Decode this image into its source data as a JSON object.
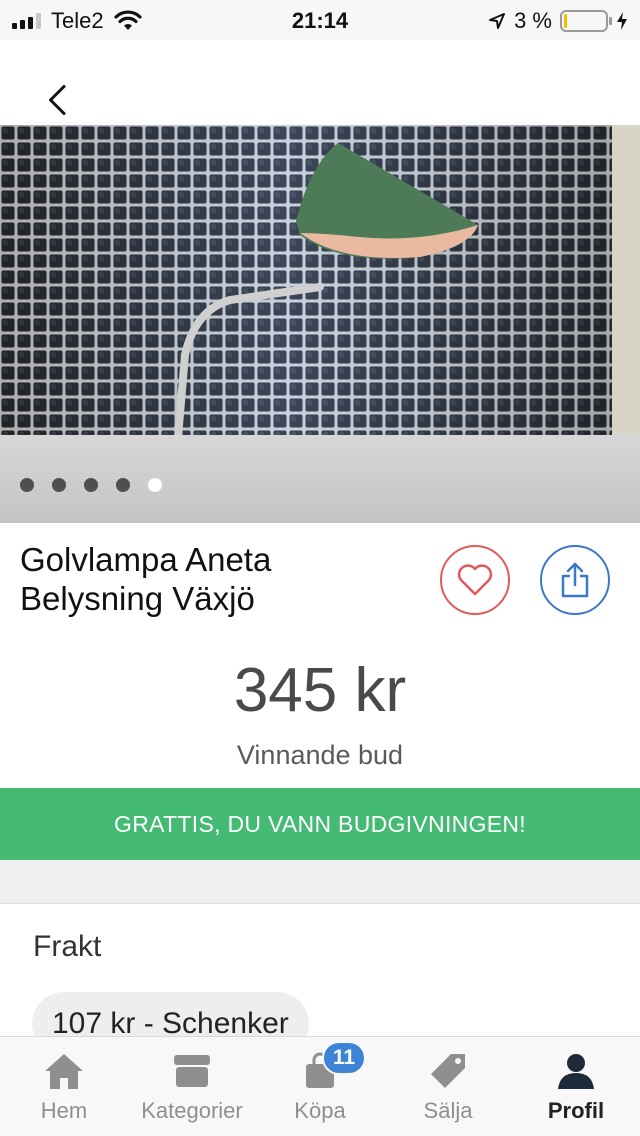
{
  "status_bar": {
    "carrier": "Tele2",
    "time": "21:14",
    "battery_percent": "3 %"
  },
  "gallery": {
    "image_count": 5,
    "active_index": 4
  },
  "listing": {
    "title_line1": "Golvlampa Aneta",
    "title_line2": "Belysning Växjö",
    "price": "345 kr",
    "price_label": "Vinnande bud",
    "win_banner": "GRATTIS, DU VANN BUDGIVNINGEN!"
  },
  "shipping": {
    "title": "Frakt",
    "option": "107 kr - Schenker"
  },
  "tabs": [
    {
      "label": "Hem",
      "icon": "home-icon"
    },
    {
      "label": "Kategorier",
      "icon": "box-icon"
    },
    {
      "label": "Köpa",
      "icon": "shopping-bag-icon",
      "badge": "11"
    },
    {
      "label": "Sälja",
      "icon": "tag-icon"
    },
    {
      "label": "Profil",
      "icon": "profile-icon"
    }
  ],
  "colors": {
    "accent_green": "#45ba74",
    "favorite_red": "#e05a5a",
    "share_blue": "#3d78c8",
    "badge_blue": "#3d84d6"
  }
}
